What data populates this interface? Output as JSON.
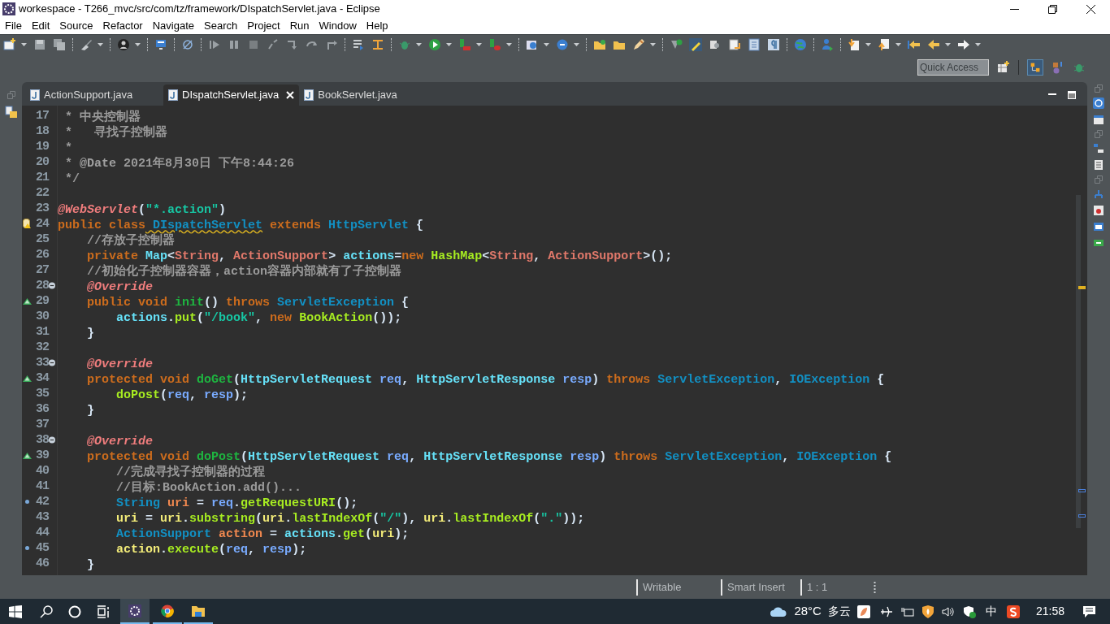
{
  "window": {
    "title": "workespace - T266_mvc/src/com/tz/framework/DIspatchServlet.java - Eclipse"
  },
  "menu": [
    "File",
    "Edit",
    "Source",
    "Refactor",
    "Navigate",
    "Search",
    "Project",
    "Run",
    "Window",
    "Help"
  ],
  "quick_access": {
    "placeholder": "Quick Access"
  },
  "tabs": [
    {
      "label": "ActionSupport.java",
      "selected": false
    },
    {
      "label": "DIspatchServlet.java",
      "selected": true
    },
    {
      "label": "BookServlet.java",
      "selected": false
    }
  ],
  "editor": {
    "lines": [
      {
        "n": "17",
        "code": [
          {
            "kind": "comment",
            "text": " * 中央控制器"
          }
        ]
      },
      {
        "n": "18",
        "code": [
          {
            "kind": "comment",
            "text": " *   寻找子控制器"
          }
        ]
      },
      {
        "n": "19",
        "code": [
          {
            "kind": "comment",
            "text": " *"
          }
        ]
      },
      {
        "n": "20",
        "code": [
          {
            "kind": "comment",
            "text": " * "
          },
          {
            "kind": "tag",
            "text": "@Date"
          },
          {
            "kind": "comment",
            "text": " 2021年8月30日 下午8:44:26"
          }
        ]
      },
      {
        "n": "21",
        "code": [
          {
            "kind": "comment",
            "text": " */"
          }
        ]
      },
      {
        "n": "22"
      },
      {
        "n": "23",
        "code": [
          {
            "kind": "annotation",
            "text": "@WebServlet"
          },
          {
            "kind": "plain",
            "text": "("
          },
          {
            "kind": "string",
            "text": "\"*.action\""
          },
          {
            "kind": "plain",
            "text": ")"
          }
        ]
      },
      {
        "n": "24",
        "kind": "warning",
        "code": [
          {
            "kind": "keyword",
            "text": "public"
          },
          {
            "kind": "keyword",
            "text": " class"
          },
          {
            "kind": "warn",
            "text": " DIspatchServlet"
          },
          {
            "kind": "keyword",
            "text": " extends"
          },
          {
            "kind": "type",
            "text": " HttpServlet"
          },
          {
            "kind": "plain",
            "text": " {"
          }
        ]
      },
      {
        "n": "25",
        "code": [
          {
            "kind": "comment",
            "text": "    //存放子控制器"
          }
        ]
      },
      {
        "n": "26",
        "code": [
          {
            "kind": "keyword",
            "text": "    private"
          },
          {
            "kind": "type_ref",
            "text": " Map"
          },
          {
            "kind": "plain",
            "text": "<"
          },
          {
            "kind": "type_arg",
            "text": "String"
          },
          {
            "kind": "plain",
            "text": ","
          },
          {
            "kind": "type_arg",
            "text": " ActionSupport"
          },
          {
            "kind": "plain",
            "text": ">"
          },
          {
            "kind": "field",
            "text": " actions"
          },
          {
            "kind": "plain",
            "text": "="
          },
          {
            "kind": "keyword",
            "text": "new"
          },
          {
            "kind": "call",
            "text": " HashMap"
          },
          {
            "kind": "plain",
            "text": "<"
          },
          {
            "kind": "type_arg",
            "text": "String"
          },
          {
            "kind": "plain",
            "text": ","
          },
          {
            "kind": "type_arg",
            "text": " ActionSupport"
          },
          {
            "kind": "plain",
            "text": ">();"
          }
        ]
      },
      {
        "n": "27",
        "code": [
          {
            "kind": "comment",
            "text": "    //初始化子控制器容器，action容器内部就有了子控制器"
          }
        ]
      },
      {
        "n": "28",
        "kind": "fold",
        "code": [
          {
            "kind": "annotation",
            "text": "    @Override"
          }
        ]
      },
      {
        "n": "29",
        "kind": "override",
        "code": [
          {
            "kind": "keyword",
            "text": "    public"
          },
          {
            "kind": "keyword",
            "text": " void"
          },
          {
            "kind": "method",
            "text": " init"
          },
          {
            "kind": "plain",
            "text": "()"
          },
          {
            "kind": "keyword",
            "text": " throws"
          },
          {
            "kind": "type",
            "text": " ServletException"
          },
          {
            "kind": "plain",
            "text": " {"
          }
        ]
      },
      {
        "n": "30",
        "code": [
          {
            "kind": "field",
            "text": "        actions"
          },
          {
            "kind": "plain",
            "text": "."
          },
          {
            "kind": "call",
            "text": "put"
          },
          {
            "kind": "plain",
            "text": "("
          },
          {
            "kind": "string",
            "text": "\"/book\""
          },
          {
            "kind": "plain",
            "text": ","
          },
          {
            "kind": "keyword",
            "text": " new"
          },
          {
            "kind": "call",
            "text": " BookAction"
          },
          {
            "kind": "plain",
            "text": "());"
          }
        ]
      },
      {
        "n": "31",
        "code": [
          {
            "kind": "plain",
            "text": "    }"
          }
        ]
      },
      {
        "n": "32"
      },
      {
        "n": "33",
        "kind": "fold",
        "code": [
          {
            "kind": "annotation",
            "text": "    @Override"
          }
        ]
      },
      {
        "n": "34",
        "kind": "override",
        "code": [
          {
            "kind": "keyword",
            "text": "    protected"
          },
          {
            "kind": "keyword",
            "text": " void"
          },
          {
            "kind": "method",
            "text": " doGet"
          },
          {
            "kind": "plain",
            "text": "("
          },
          {
            "kind": "type_ref",
            "text": "HttpServletRequest"
          },
          {
            "kind": "param",
            "text": " req"
          },
          {
            "kind": "plain",
            "text": ","
          },
          {
            "kind": "type_ref",
            "text": " HttpServletResponse"
          },
          {
            "kind": "param",
            "text": " resp"
          },
          {
            "kind": "plain",
            "text": ")"
          },
          {
            "kind": "keyword",
            "text": " throws"
          },
          {
            "kind": "type",
            "text": " ServletException"
          },
          {
            "kind": "plain",
            "text": ","
          },
          {
            "kind": "type",
            "text": " IOException"
          },
          {
            "kind": "plain",
            "text": " {"
          }
        ]
      },
      {
        "n": "35",
        "code": [
          {
            "kind": "call",
            "text": "        doPost"
          },
          {
            "kind": "plain",
            "text": "("
          },
          {
            "kind": "param",
            "text": "req"
          },
          {
            "kind": "plain",
            "text": ","
          },
          {
            "kind": "param",
            "text": " resp"
          },
          {
            "kind": "plain",
            "text": ");"
          }
        ]
      },
      {
        "n": "36",
        "code": [
          {
            "kind": "plain",
            "text": "    }"
          }
        ]
      },
      {
        "n": "37"
      },
      {
        "n": "38",
        "kind": "fold",
        "code": [
          {
            "kind": "annotation",
            "text": "    @Override"
          }
        ]
      },
      {
        "n": "39",
        "kind": "override",
        "code": [
          {
            "kind": "keyword",
            "text": "    protected"
          },
          {
            "kind": "keyword",
            "text": " void"
          },
          {
            "kind": "method",
            "text": " doPost"
          },
          {
            "kind": "plain",
            "text": "("
          },
          {
            "kind": "type_ref",
            "text": "HttpServletRequest"
          },
          {
            "kind": "param",
            "text": " req"
          },
          {
            "kind": "plain",
            "text": ","
          },
          {
            "kind": "type_ref",
            "text": " HttpServletResponse"
          },
          {
            "kind": "param",
            "text": " resp"
          },
          {
            "kind": "plain",
            "text": ")"
          },
          {
            "kind": "keyword",
            "text": " throws"
          },
          {
            "kind": "type",
            "text": " ServletException"
          },
          {
            "kind": "plain",
            "text": ","
          },
          {
            "kind": "type",
            "text": " IOException"
          },
          {
            "kind": "plain",
            "text": " {"
          }
        ]
      },
      {
        "n": "40",
        "code": [
          {
            "kind": "comment",
            "text": "        //完成寻找子控制器的过程"
          }
        ]
      },
      {
        "n": "41",
        "code": [
          {
            "kind": "comment",
            "text": "        //目标:BookAction.add()..."
          }
        ]
      },
      {
        "n": "42",
        "kind": "mark",
        "code": [
          {
            "kind": "type",
            "text": "        String"
          },
          {
            "kind": "local_decl",
            "text": " uri"
          },
          {
            "kind": "plain",
            "text": " ="
          },
          {
            "kind": "param",
            "text": " req"
          },
          {
            "kind": "plain",
            "text": "."
          },
          {
            "kind": "call",
            "text": "getRequestURI"
          },
          {
            "kind": "plain",
            "text": "();"
          }
        ]
      },
      {
        "n": "43",
        "code": [
          {
            "kind": "local",
            "text": "        uri"
          },
          {
            "kind": "plain",
            "text": " ="
          },
          {
            "kind": "local",
            "text": " uri"
          },
          {
            "kind": "plain",
            "text": "."
          },
          {
            "kind": "call",
            "text": "substring"
          },
          {
            "kind": "plain",
            "text": "("
          },
          {
            "kind": "local",
            "text": "uri"
          },
          {
            "kind": "plain",
            "text": "."
          },
          {
            "kind": "call",
            "text": "lastIndexOf"
          },
          {
            "kind": "plain",
            "text": "("
          },
          {
            "kind": "string",
            "text": "\"/\""
          },
          {
            "kind": "plain",
            "text": "),"
          },
          {
            "kind": "local",
            "text": " uri"
          },
          {
            "kind": "plain",
            "text": "."
          },
          {
            "kind": "call",
            "text": "lastIndexOf"
          },
          {
            "kind": "plain",
            "text": "("
          },
          {
            "kind": "string",
            "text": "\".\""
          },
          {
            "kind": "plain",
            "text": "));"
          }
        ]
      },
      {
        "n": "44",
        "code": [
          {
            "kind": "type",
            "text": "        ActionSupport"
          },
          {
            "kind": "local_decl",
            "text": " action"
          },
          {
            "kind": "plain",
            "text": " ="
          },
          {
            "kind": "field",
            "text": " actions"
          },
          {
            "kind": "plain",
            "text": "."
          },
          {
            "kind": "call",
            "text": "get"
          },
          {
            "kind": "plain",
            "text": "("
          },
          {
            "kind": "local",
            "text": "uri"
          },
          {
            "kind": "plain",
            "text": ");"
          }
        ]
      },
      {
        "n": "45",
        "kind": "mark",
        "code": [
          {
            "kind": "local",
            "text": "        action"
          },
          {
            "kind": "plain",
            "text": "."
          },
          {
            "kind": "call",
            "text": "execute"
          },
          {
            "kind": "plain",
            "text": "("
          },
          {
            "kind": "param",
            "text": "req"
          },
          {
            "kind": "plain",
            "text": ","
          },
          {
            "kind": "param",
            "text": " resp"
          },
          {
            "kind": "plain",
            "text": ");"
          }
        ]
      },
      {
        "n": "46",
        "code": [
          {
            "kind": "plain",
            "text": "    }"
          }
        ]
      }
    ]
  },
  "status_bar": [
    "Writable",
    "Smart Insert",
    "1 : 1"
  ],
  "taskbar": {
    "temperature": "28°C",
    "weather": "多云",
    "ime": "中",
    "time": "21:58"
  }
}
